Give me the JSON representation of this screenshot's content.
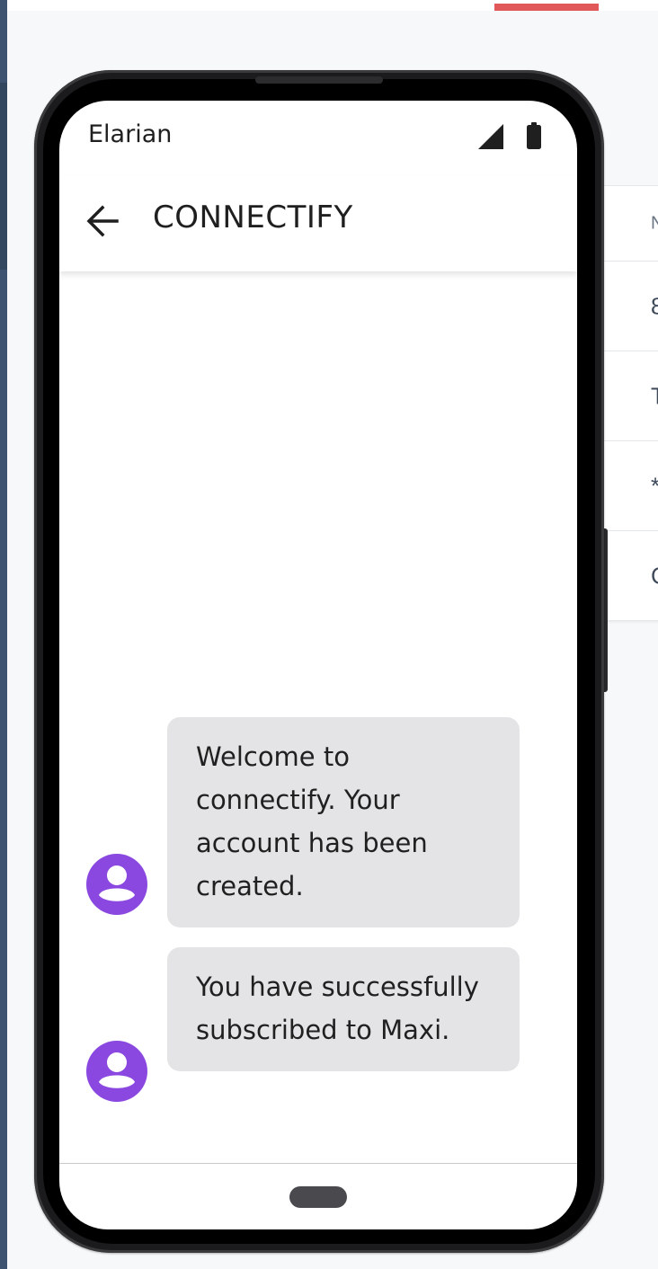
{
  "status_bar": {
    "carrier": "Elarian",
    "signal_icon": "cell-signal-icon",
    "battery_icon": "battery-icon"
  },
  "app_bar": {
    "back_icon": "arrow-back-icon",
    "title": "CONNECTIFY"
  },
  "messages": [
    {
      "sender_icon": "account-circle-icon",
      "text": "Welcome to connectify. Your account has been created."
    },
    {
      "sender_icon": "account-circle-icon",
      "text": "You have successfully subscribed to Maxi."
    }
  ],
  "background_table": {
    "rows": [
      "N",
      "8",
      "T",
      "*",
      "C"
    ]
  },
  "colors": {
    "avatar": "#8a48e0",
    "bubble": "#e4e4e6",
    "accent_line": "#e0585a"
  }
}
